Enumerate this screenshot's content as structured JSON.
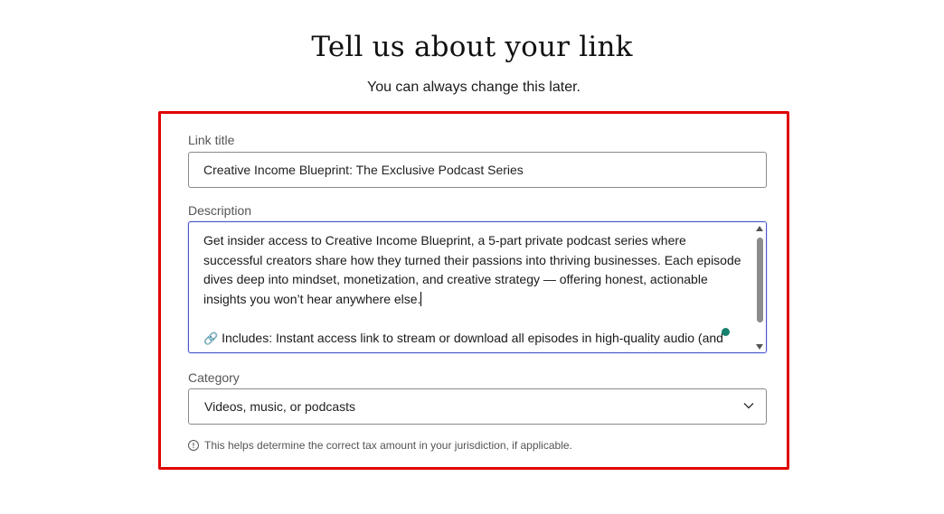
{
  "header": {
    "title": "Tell us about your link",
    "subtitle": "You can always change this later."
  },
  "form": {
    "link_title": {
      "label": "Link title",
      "value": "Creative Income Blueprint: The Exclusive Podcast Series"
    },
    "description": {
      "label": "Description",
      "paragraph1": "Get insider access to Creative Income Blueprint, a 5-part private podcast series where successful creators share how they turned their passions into thriving businesses. Each episode dives deep into mindset, monetization, and creative strategy — offering honest, actionable insights you won’t hear anywhere else.",
      "includes_icon": "link-icon",
      "includes_line": "Includes: Instant access link to stream or download all episodes in high-quality audio (and"
    },
    "category": {
      "label": "Category",
      "selected": "Videos, music, or podcasts"
    },
    "help_text": "This helps determine the correct tax amount in your jurisdiction, if applicable."
  },
  "colors": {
    "highlight_border": "#e00000",
    "focus_border": "#4a55c8",
    "grammarly_dot": "#15806d"
  }
}
